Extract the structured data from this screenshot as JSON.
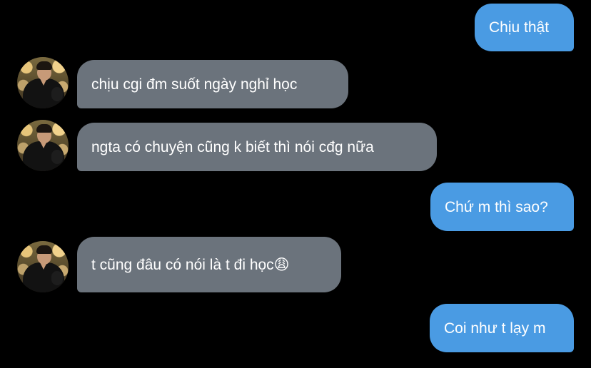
{
  "conversation": {
    "messages": [
      {
        "direction": "outgoing",
        "text": "Chịu thật"
      },
      {
        "direction": "incoming",
        "text": "chịu cgi đm suốt ngày nghỉ học"
      },
      {
        "direction": "incoming",
        "text": "ngta có chuyện cũng k biết thì nói cđg nữa"
      },
      {
        "direction": "outgoing",
        "text": "Chứ m thì sao?"
      },
      {
        "direction": "incoming",
        "text": "t cũng đâu có nói là t đi học😩"
      },
      {
        "direction": "outgoing",
        "text": "Coi như t lạy m"
      }
    ]
  },
  "colors": {
    "background": "#000000",
    "outgoing_bubble": "#4a9be3",
    "incoming_bubble": "#6b737c",
    "text": "#ffffff"
  },
  "icons": {
    "avatar": "contact-avatar-photo"
  }
}
